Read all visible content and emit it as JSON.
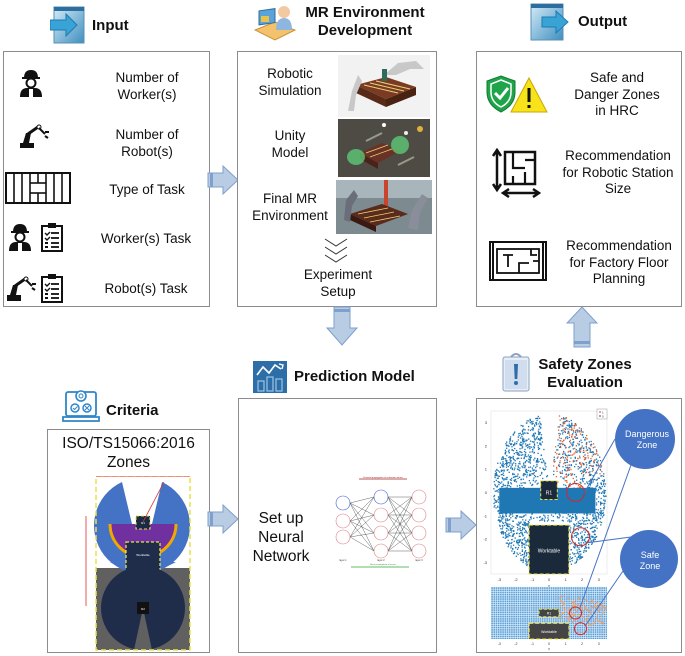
{
  "sections": {
    "input": {
      "title": "Input",
      "icon": "input-arrow-icon",
      "items": [
        {
          "label_line1": "Number of",
          "label_line2": "Worker(s)",
          "icon": "worker-icon"
        },
        {
          "label_line1": "Number of",
          "label_line2": "Robot(s)",
          "icon": "robot-arm-icon"
        },
        {
          "label": "Type of Task",
          "icon": "task-grid-icon"
        },
        {
          "label": "Worker(s) Task",
          "icon": "worker-checklist-icon"
        },
        {
          "label": "Robot(s) Task",
          "icon": "robot-checklist-icon"
        }
      ]
    },
    "mr_environment": {
      "title_line1": "MR Environment",
      "title_line2": "Development",
      "icon": "developer-computer-icon",
      "items": [
        {
          "label_line1": "Robotic",
          "label_line2": "Simulation",
          "image": "robotic-simulation-image"
        },
        {
          "label_line1": "Unity",
          "label_line2": "Model",
          "image": "unity-model-image"
        },
        {
          "label_line1": "Final MR",
          "label_line2": "Environment",
          "image": "final-mr-environment-image"
        }
      ],
      "footer_line1": "Experiment",
      "footer_line2": "Setup"
    },
    "output": {
      "title": "Output",
      "icon": "output-arrow-icon",
      "items": [
        {
          "line1": "Safe and",
          "line2": "Danger Zones",
          "line3": "in HRC",
          "icon": "shield-warning-icon"
        },
        {
          "line1": "Recommendation",
          "line2": "for Robotic Station",
          "line3": "Size",
          "icon": "station-size-icon"
        },
        {
          "line1": "Recommendation",
          "line2": "for Factory Floor",
          "line3": "Planning",
          "icon": "floor-plan-icon"
        }
      ]
    },
    "criteria": {
      "title": "Criteria",
      "icon": "laptop-gear-icon",
      "heading_line1": "ISO/TS15066:2016",
      "heading_line2": "Zones",
      "diagram_labels": {
        "workstation": "Worktable",
        "robot1": "R1",
        "robot2": "R2"
      }
    },
    "prediction": {
      "title": "Prediction Model",
      "icon": "chart-trend-icon",
      "label_line1": "Set up",
      "label_line2": "Neural",
      "label_line3": "Network",
      "nn_labels": {
        "forward": "Forward propagation of activation values",
        "backward": "Back propagation of errors",
        "layer1": "layer 1",
        "layer2": "layer 2",
        "layer3": "layer 3"
      }
    },
    "evaluation": {
      "title_line1": "Safety Zones",
      "title_line2": "Evaluation",
      "icon": "clipboard-alert-icon",
      "dangerous_line1": "Dangerous",
      "dangerous_line2": "Zone",
      "safe_line1": "Safe",
      "safe_line2": "Zone",
      "plot_labels": {
        "robot": "R1",
        "worktable": "Worktable",
        "xlabel": "x",
        "ylabel": "y",
        "legend": [
          "1",
          "0"
        ],
        "xticks": [
          "-3",
          "-2",
          "-1",
          "0",
          "1",
          "2",
          "3"
        ],
        "yticks": [
          "3",
          "2",
          "1",
          "0",
          "-1",
          "-2",
          "-3"
        ]
      }
    }
  },
  "colors": {
    "arrow_fill": "#b8cce4",
    "arrow_stroke": "#7f9fcc",
    "zone_circle": "#4472c4",
    "scatter_blue": "#1f77b4",
    "scatter_orange": "#e8612c",
    "danger_red": "#d62728"
  }
}
